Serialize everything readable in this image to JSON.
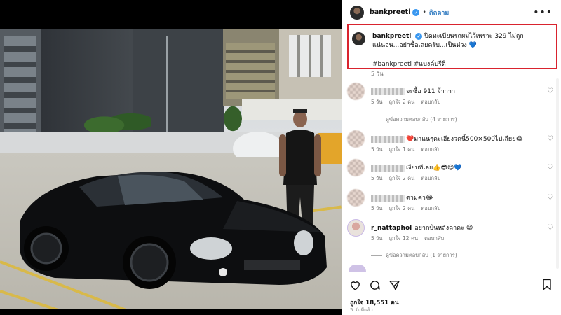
{
  "post": {
    "username": "bankpreeti",
    "separator": "•",
    "follow_label": "ติดตาม",
    "more_icon": "more-horizontal-icon",
    "caption": {
      "username": "bankpreeti",
      "text": "ปิดทะเบียนรถผมไว้เพราะ 329 ไม่ถูกแน่นอน...อย่าซื้อเลยครับ...เป็นห่วง 💙",
      "hashtags": "#bankpreeti #แบงค์ปรีติ",
      "time": "5 วัน"
    },
    "highlight_color": "#d9232e"
  },
  "comments": [
    {
      "name_hidden": true,
      "text": "จะซื้อ 911 จ้าาาา",
      "time": "5 วัน",
      "likes": "ถูกใจ 2 คน",
      "reply_label": "ตอบกลับ",
      "replies": "ดูข้อความตอบกลับ (4 รายการ)"
    },
    {
      "name_hidden": true,
      "text": "❤️มาแนๆคะเฮียงวดนี้500×500ไปเลียย😂",
      "time": "5 วัน",
      "likes": "ถูกใจ 1 คน",
      "reply_label": "ตอบกลับ",
      "replies": ""
    },
    {
      "name_hidden": true,
      "text": "เงียบทีเลย👍😎😊💙",
      "time": "5 วัน",
      "likes": "ถูกใจ 2 คน",
      "reply_label": "ตอบกลับ",
      "replies": ""
    },
    {
      "name_hidden": true,
      "text": "ตามค่า😂",
      "time": "5 วัน",
      "likes": "ถูกใจ 2 คน",
      "reply_label": "ตอบกลับ",
      "replies": ""
    },
    {
      "name_hidden": false,
      "name": "r_nattaphol",
      "text": "อยากบินหลังคาคะ 😁",
      "time": "5 วัน",
      "likes": "ถูกใจ 12 คน",
      "reply_label": "ตอบกลับ",
      "replies": "ดูข้อความตอบกลับ (1 รายการ)"
    }
  ],
  "footer": {
    "icons": [
      "heart-icon",
      "comment-icon",
      "share-icon",
      "bookmark-icon"
    ],
    "likes_text": "ถูกใจ 18,551 คน",
    "posted_ago": "5 วันที่แล้ว"
  }
}
